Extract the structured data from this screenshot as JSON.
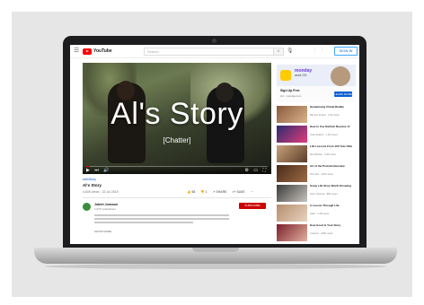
{
  "header": {
    "logo_text": "YouTube",
    "search_placeholder": "Search",
    "signin_label": "SIGN IN"
  },
  "player": {
    "overlay_title": "Al's Story",
    "overlay_subtitle": "[Chatter]",
    "progress": 0.02
  },
  "video": {
    "hashtags": "#AlsStory",
    "title": "Al's Story",
    "views": "4,605 views · 22 Jul 2019",
    "actions": [
      "👍 58",
      "👎 1",
      "↗ SHARE",
      "≡+ SAVE",
      "···"
    ]
  },
  "channel": {
    "name": "Jobert Jonsson",
    "subs": "1.07K subscribers",
    "subscribe_label": "SUBSCRIBE",
    "show_more": "SHOW MORE"
  },
  "ad": {
    "brand": "monday",
    "brand_sub": "work OS",
    "title": "Sign Up Free",
    "sub": "Ad · monday.com",
    "button": "LEARN MORE"
  },
  "recommendations": [
    {
      "title": "Humanising Virtual Reality",
      "meta": "Barriers Project · 2.3K views",
      "colors": [
        "#8a5a3c",
        "#d8b48a"
      ]
    },
    {
      "title": "How to Use DaVinci Resolve 17",
      "meta": "Video Editors · 1.1M views",
      "colors": [
        "#2b2b6e",
        "#e23d7a"
      ]
    },
    {
      "title": "Life Lessons From 100 Year Olds",
      "meta": "Mind Buddy · 5.4M views",
      "colors": [
        "#c9a27a",
        "#5a3d2b"
      ]
    },
    {
      "title": "Art of the Portrait Interview",
      "meta": "Film Riot · 420K views",
      "colors": [
        "#4a2a1a",
        "#9c6b44"
      ]
    },
    {
      "title": "Some Life Story Worth Knowing",
      "meta": "Story Channel · 88K views",
      "colors": [
        "#3b3b3b",
        "#c7c2bd"
      ]
    },
    {
      "title": "A Lesson Through Life",
      "meta": "Talks · 1.2M views",
      "colors": [
        "#b58d6c",
        "#e8d4c0"
      ]
    },
    {
      "title": "How Good Is Your Story",
      "meta": "Creators · 330K views",
      "colors": [
        "#7c1f2a",
        "#e2b0a0"
      ]
    }
  ]
}
